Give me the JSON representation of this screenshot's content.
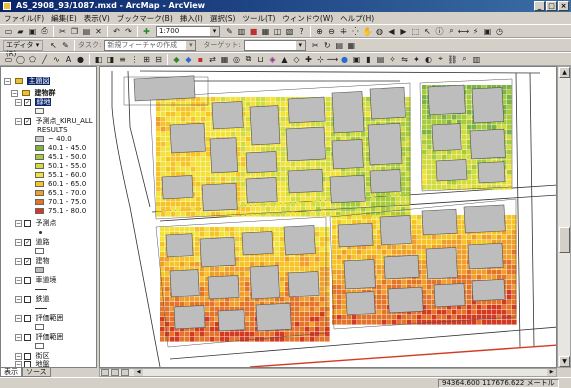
{
  "window": {
    "title": "AS_2908_93/1087.mxd - ArcMap - ArcView"
  },
  "menu": [
    "ファイル(F)",
    "編集(E)",
    "表示(V)",
    "ブックマーク(B)",
    "挿入(I)",
    "選択(S)",
    "ツール(T)",
    "ウィンドウ(W)",
    "ヘルプ(H)"
  ],
  "toolbar": {
    "scale_value": "1:700",
    "editor_label": "エディタ(R)",
    "task_label": "タスク:",
    "task_value": "新規フィーチャの作成",
    "target_label": "ターゲット:",
    "target_value": ""
  },
  "toc": {
    "dataframe": "主題図",
    "group": "建物群",
    "layers": [
      {
        "name": "緑地"
      },
      {
        "name": "予測点_KIRU_ALL"
      },
      {
        "name": "予測点"
      },
      {
        "name": "道路"
      },
      {
        "name": "建物"
      },
      {
        "name": "車道境"
      },
      {
        "name": "鉄道"
      },
      {
        "name": "評価範囲"
      },
      {
        "name": "評価範囲"
      },
      {
        "name": "街区"
      },
      {
        "name": "地盤"
      }
    ],
    "field": "RESULTS",
    "legend": [
      {
        "label": "~ 40.0",
        "color": "#c8c8c8"
      },
      {
        "label": "40.1 - 45.0",
        "color": "#7cb342"
      },
      {
        "label": "45.1 - 50.0",
        "color": "#a6cc3a"
      },
      {
        "label": "50.1 - 55.0",
        "color": "#d2dc3c"
      },
      {
        "label": "55.1 - 60.0",
        "color": "#f3e23a"
      },
      {
        "label": "60.1 - 65.0",
        "color": "#f6c426"
      },
      {
        "label": "65.1 - 70.0",
        "color": "#f0a02a"
      },
      {
        "label": "70.1 - 75.0",
        "color": "#e4742a"
      },
      {
        "label": "75.1 - 80.0",
        "color": "#d43a22"
      }
    ],
    "tabs": [
      "表示",
      "ソース"
    ]
  },
  "status": {
    "coordinates": "94364.600  117676.622 メートル"
  }
}
